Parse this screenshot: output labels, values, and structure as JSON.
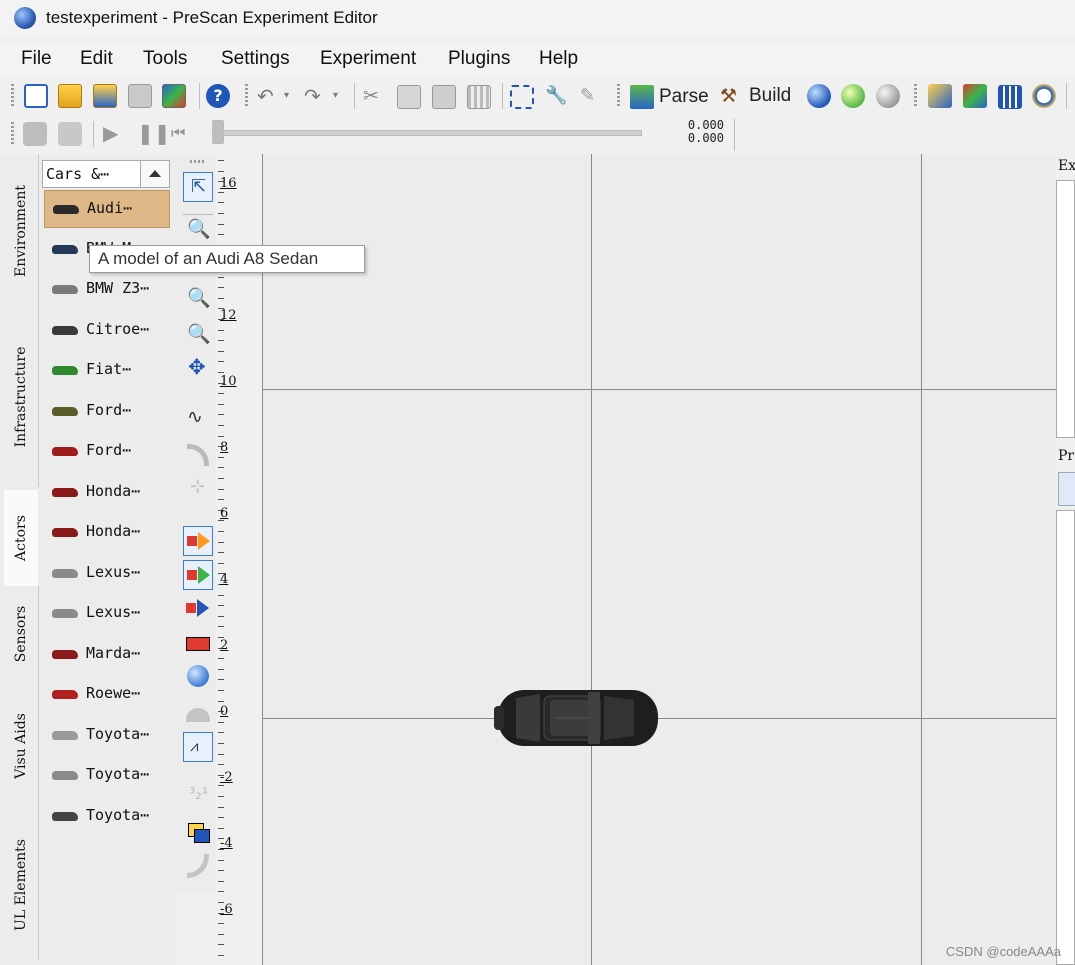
{
  "window": {
    "title": "testexperiment - PreScan Experiment Editor"
  },
  "menu": [
    "File",
    "Edit",
    "Tools",
    "Settings",
    "Experiment",
    "Plugins",
    "Help"
  ],
  "toolbar": {
    "parse_label": "Parse",
    "build_label": "Build",
    "readout_top": "0.000",
    "readout_bottom": "0.000",
    "icons": [
      "new-icon",
      "open-icon",
      "open-folder-icon",
      "save-icon",
      "edit-icon",
      "help-icon",
      "undo-icon",
      "redo-icon",
      "cut-icon",
      "copy-icon",
      "paste-icon",
      "grid-icon",
      "select-area-icon",
      "wrench-icon",
      "pencil-icon",
      "parse-icon",
      "build-icon",
      "globe-icon",
      "globe-icon",
      "sphere-icon",
      "ruler-icon",
      "tools-icon",
      "table-icon",
      "gauge-icon"
    ]
  },
  "side_tabs": [
    "Environment",
    "Infrastructure",
    "Actors",
    "Sensors",
    "Visu Aids",
    "UL Elements"
  ],
  "active_tab": "Actors",
  "actor_list": {
    "header": "Cars &⋯",
    "items": [
      {
        "label": "Audi⋯",
        "color": "#2a2a2a",
        "selected": true
      },
      {
        "label": "BMW M⋯",
        "color": "#233a57",
        "selected": false
      },
      {
        "label": "BMW Z3⋯",
        "color": "#7a7a7a",
        "selected": false
      },
      {
        "label": "Citroe⋯",
        "color": "#3a3a3a",
        "selected": false
      },
      {
        "label": "Fiat⋯",
        "color": "#2f8a2f",
        "selected": false
      },
      {
        "label": "Ford⋯",
        "color": "#5a5a2a",
        "selected": false
      },
      {
        "label": "Ford⋯",
        "color": "#a01c1c",
        "selected": false
      },
      {
        "label": "Honda⋯",
        "color": "#8a1a1a",
        "selected": false
      },
      {
        "label": "Honda⋯",
        "color": "#8a1a1a",
        "selected": false
      },
      {
        "label": "Lexus⋯",
        "color": "#8a8a8a",
        "selected": false
      },
      {
        "label": "Lexus⋯",
        "color": "#8a8a8a",
        "selected": false
      },
      {
        "label": "Marda⋯",
        "color": "#8a1a1a",
        "selected": false
      },
      {
        "label": "Roewe⋯",
        "color": "#b02020",
        "selected": false
      },
      {
        "label": "Toyota⋯",
        "color": "#9a9a9a",
        "selected": false
      },
      {
        "label": "Toyota⋯",
        "color": "#8a8a8a",
        "selected": false
      },
      {
        "label": "Toyota⋯",
        "color": "#444444",
        "selected": false
      }
    ]
  },
  "tooltip": "A model of an Audi A8 Sedan",
  "ruler_labels": [
    "16",
    "12",
    "10",
    "8",
    "6",
    "4",
    "2",
    "0",
    "-2",
    "-4",
    "-6"
  ],
  "right_panel": {
    "label_top": "Ex",
    "label_mid": "Pr"
  },
  "watermark": "CSDN @codeAAAa"
}
